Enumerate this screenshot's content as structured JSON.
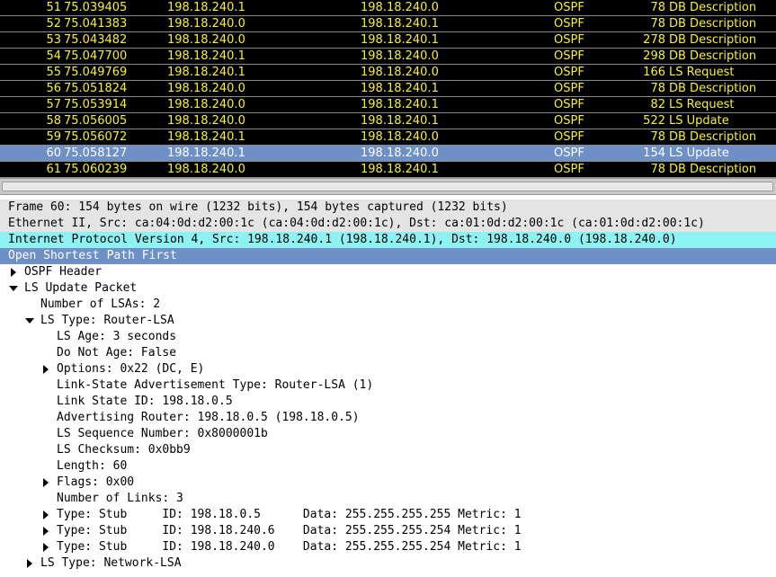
{
  "packets": [
    {
      "no": "51",
      "time": "75.039405",
      "src": "198.18.240.1",
      "dst": "198.18.240.0",
      "proto": "OSPF",
      "len": "78",
      "info": "DB Description"
    },
    {
      "no": "52",
      "time": "75.041383",
      "src": "198.18.240.0",
      "dst": "198.18.240.1",
      "proto": "OSPF",
      "len": "78",
      "info": "DB Description"
    },
    {
      "no": "53",
      "time": "75.043482",
      "src": "198.18.240.0",
      "dst": "198.18.240.1",
      "proto": "OSPF",
      "len": "278",
      "info": "DB Description"
    },
    {
      "no": "54",
      "time": "75.047700",
      "src": "198.18.240.1",
      "dst": "198.18.240.0",
      "proto": "OSPF",
      "len": "298",
      "info": "DB Description"
    },
    {
      "no": "55",
      "time": "75.049769",
      "src": "198.18.240.1",
      "dst": "198.18.240.0",
      "proto": "OSPF",
      "len": "166",
      "info": "LS Request"
    },
    {
      "no": "56",
      "time": "75.051824",
      "src": "198.18.240.0",
      "dst": "198.18.240.1",
      "proto": "OSPF",
      "len": "78",
      "info": "DB Description"
    },
    {
      "no": "57",
      "time": "75.053914",
      "src": "198.18.240.0",
      "dst": "198.18.240.1",
      "proto": "OSPF",
      "len": "82",
      "info": "LS Request"
    },
    {
      "no": "58",
      "time": "75.056005",
      "src": "198.18.240.0",
      "dst": "198.18.240.1",
      "proto": "OSPF",
      "len": "522",
      "info": "LS Update"
    },
    {
      "no": "59",
      "time": "75.056072",
      "src": "198.18.240.1",
      "dst": "198.18.240.0",
      "proto": "OSPF",
      "len": "78",
      "info": "DB Description"
    },
    {
      "no": "60",
      "time": "75.058127",
      "src": "198.18.240.1",
      "dst": "198.18.240.0",
      "proto": "OSPF",
      "len": "154",
      "info": "LS Update",
      "selected": true
    },
    {
      "no": "61",
      "time": "75.060239",
      "src": "198.18.240.0",
      "dst": "198.18.240.1",
      "proto": "OSPF",
      "len": "78",
      "info": "DB Description"
    }
  ],
  "details": [
    {
      "text": "Frame 60: 154 bytes on wire (1232 bits), 154 bytes captured (1232 bits)",
      "indent": 0,
      "toggle": "none",
      "bg": "gray"
    },
    {
      "text": "Ethernet II, Src: ca:04:0d:d2:00:1c (ca:04:0d:d2:00:1c), Dst: ca:01:0d:d2:00:1c (ca:01:0d:d2:00:1c)",
      "indent": 0,
      "toggle": "none",
      "bg": "gray"
    },
    {
      "text": "Internet Protocol Version 4, Src: 198.18.240.1 (198.18.240.1), Dst: 198.18.240.0 (198.18.240.0)",
      "indent": 0,
      "toggle": "none",
      "bg": "cyan"
    },
    {
      "text": "Open Shortest Path First",
      "indent": 0,
      "toggle": "none",
      "bg": "blue"
    },
    {
      "text": "OSPF Header",
      "indent": 1,
      "toggle": "collapsed",
      "bg": ""
    },
    {
      "text": "LS Update Packet",
      "indent": 1,
      "toggle": "expanded",
      "bg": ""
    },
    {
      "text": "Number of LSAs: 2",
      "indent": 2,
      "toggle": "none",
      "bg": ""
    },
    {
      "text": "LS Type: Router-LSA",
      "indent": 2,
      "toggle": "expanded",
      "bg": ""
    },
    {
      "text": "LS Age: 3 seconds",
      "indent": 3,
      "toggle": "none",
      "bg": ""
    },
    {
      "text": "Do Not Age: False",
      "indent": 3,
      "toggle": "none",
      "bg": ""
    },
    {
      "text": "Options: 0x22 (DC, E)",
      "indent": 3,
      "toggle": "collapsed",
      "bg": ""
    },
    {
      "text": "Link-State Advertisement Type: Router-LSA (1)",
      "indent": 3,
      "toggle": "none",
      "bg": ""
    },
    {
      "text": "Link State ID: 198.18.0.5",
      "indent": 3,
      "toggle": "none",
      "bg": ""
    },
    {
      "text": "Advertising Router: 198.18.0.5 (198.18.0.5)",
      "indent": 3,
      "toggle": "none",
      "bg": ""
    },
    {
      "text": "LS Sequence Number: 0x8000001b",
      "indent": 3,
      "toggle": "none",
      "bg": ""
    },
    {
      "text": "LS Checksum: 0x0bb9",
      "indent": 3,
      "toggle": "none",
      "bg": ""
    },
    {
      "text": "Length: 60",
      "indent": 3,
      "toggle": "none",
      "bg": ""
    },
    {
      "text": "Flags: 0x00",
      "indent": 3,
      "toggle": "collapsed",
      "bg": ""
    },
    {
      "text": "Number of Links: 3",
      "indent": 3,
      "toggle": "none",
      "bg": ""
    },
    {
      "text": "Type: Stub     ID: 198.18.0.5      Data: 255.255.255.255 Metric: 1",
      "indent": 3,
      "toggle": "collapsed",
      "bg": ""
    },
    {
      "text": "Type: Stub     ID: 198.18.240.6    Data: 255.255.255.254 Metric: 1",
      "indent": 3,
      "toggle": "collapsed",
      "bg": ""
    },
    {
      "text": "Type: Stub     ID: 198.18.240.0    Data: 255.255.255.254 Metric: 1",
      "indent": 3,
      "toggle": "collapsed",
      "bg": ""
    },
    {
      "text": "LS Type: Network-LSA",
      "indent": 2,
      "toggle": "collapsed",
      "bg": ""
    }
  ],
  "colors": {
    "list_bg": "#000000",
    "list_text": "#f5ef3a",
    "selected_bg": "#6f8fc7",
    "frame_bg": "#e4e4e4",
    "ip_bg": "#8ff2f2"
  },
  "icons": {
    "collapsed": "triangle-right-icon",
    "expanded": "triangle-down-icon"
  }
}
